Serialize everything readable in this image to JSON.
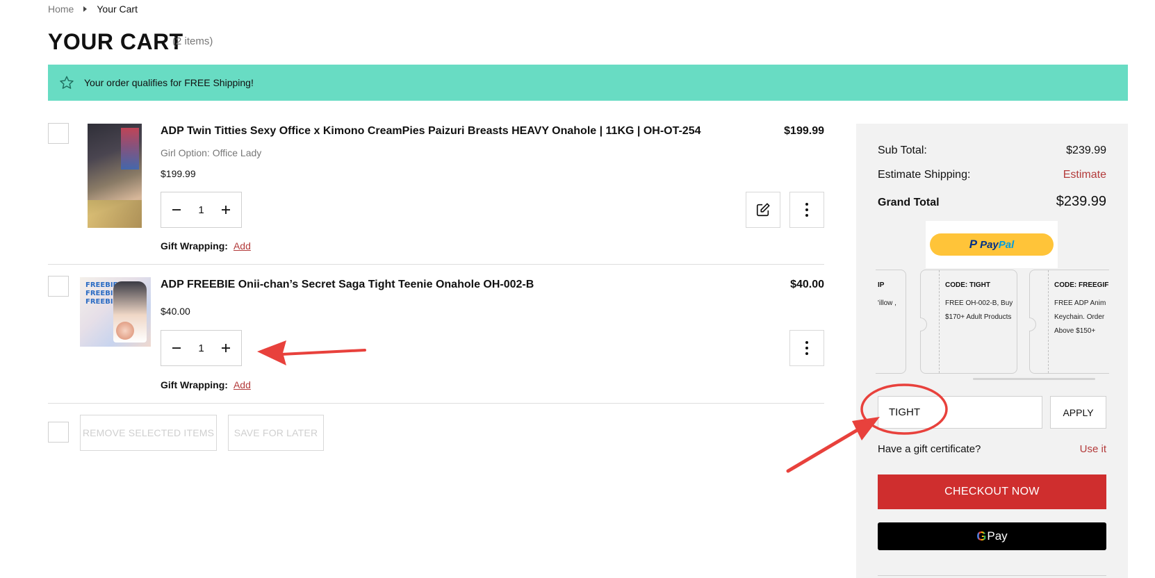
{
  "breadcrumb": {
    "home": "Home",
    "current": "Your Cart"
  },
  "page": {
    "title": "YOUR CART",
    "item_count": "(2 items)"
  },
  "banner": {
    "icon": "star-icon",
    "message": "Your order qualifies for FREE Shipping!",
    "color": "#68dcc3"
  },
  "items": [
    {
      "title": "ADP Twin Titties Sexy Office x Kimono CreamPies Paizuri Breasts HEAVY Onahole | 11KG | OH-OT-254",
      "price": "$199.99",
      "option_label": "Girl Option:",
      "option_value": "Office Lady",
      "unit_price": "$199.99",
      "quantity": "1",
      "gift_label": "Gift Wrapping:",
      "gift_action": "Add"
    },
    {
      "title": "ADP FREEBIE Onii-chan’s Secret Saga Tight Teenie Onahole OH-002-B",
      "price": "$40.00",
      "unit_price": "$40.00",
      "quantity": "1",
      "gift_label": "Gift Wrapping:",
      "gift_action": "Add",
      "image_text": [
        "FREEBIE",
        "FREEBIE",
        "FREEBIE"
      ]
    }
  ],
  "actions": {
    "remove_selected": "REMOVE SELECTED ITEMS",
    "save_for_later": "SAVE FOR LATER"
  },
  "summary": {
    "subtotal_label": "Sub Total:",
    "subtotal_value": "$239.99",
    "shipping_label": "Estimate Shipping:",
    "shipping_action": "Estimate",
    "grand_total_label": "Grand Total",
    "grand_total_value": "$239.99",
    "paypal_label_1": "Pay",
    "paypal_label_2": "Pal",
    "coupons": [
      {
        "code": "IP",
        "desc": "'illow ,"
      },
      {
        "code": "CODE: TIGHT",
        "desc": "FREE OH-002-B, Buy $170+ Adult Products"
      },
      {
        "code": "CODE: FREEGIF",
        "desc": "FREE ADP Anim Keychain. Order Above $150+"
      }
    ],
    "coupon_input_value": "TIGHT",
    "apply_label": "APPLY",
    "gift_cert_label": "Have a gift certificate?",
    "gift_cert_action": "Use it",
    "checkout_label": "CHECKOUT NOW",
    "gpay_g": "G",
    "gpay_label": "Pay"
  },
  "colors": {
    "accent_red": "#cf2e2e",
    "link_red": "#b33a3a",
    "annotation_red": "#e8413c"
  }
}
